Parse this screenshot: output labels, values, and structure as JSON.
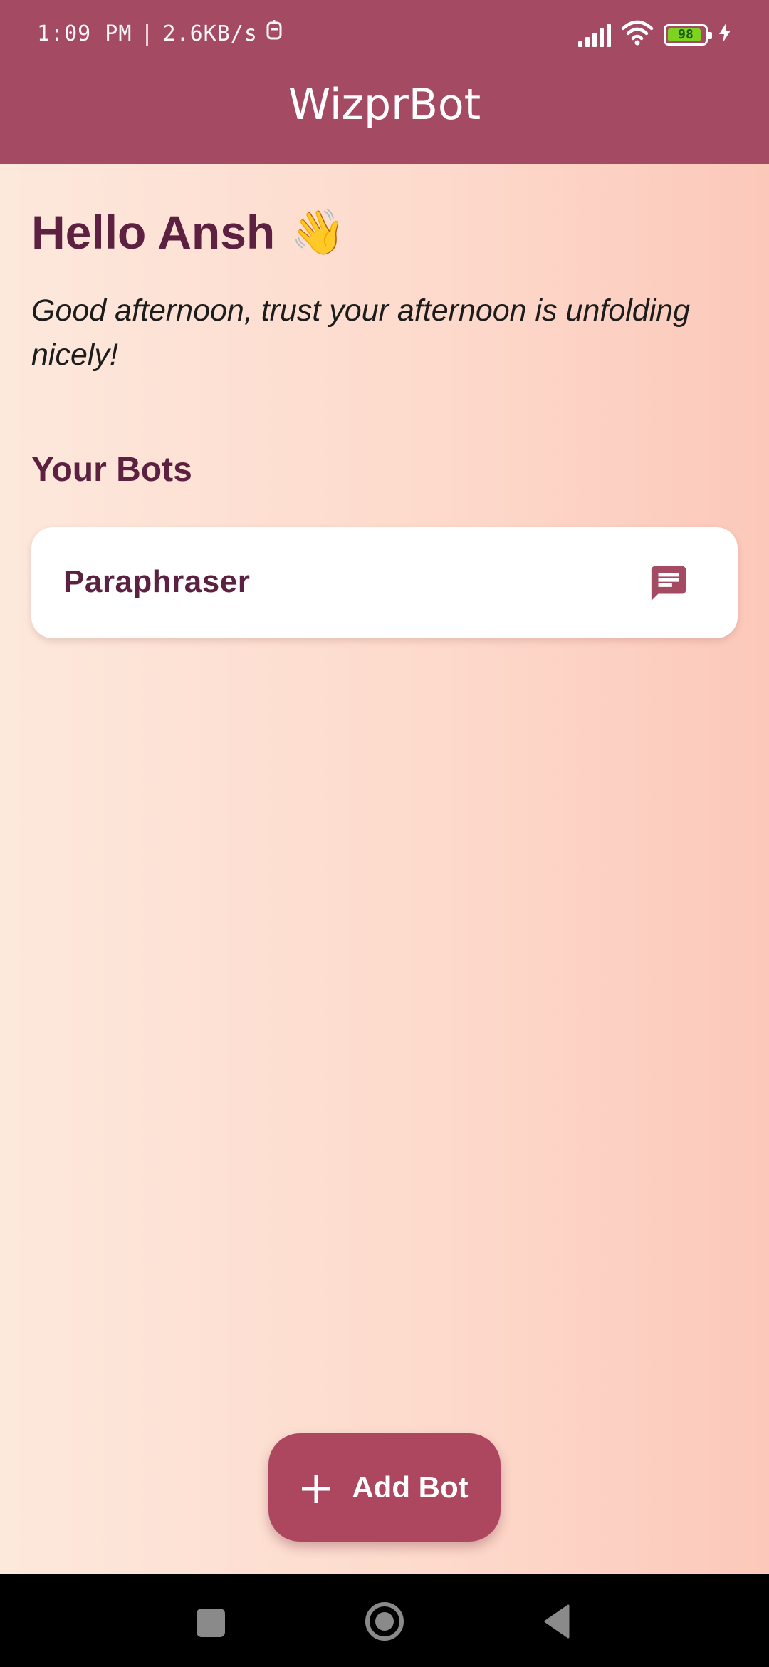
{
  "status_bar": {
    "time": "1:09 PM",
    "separator": "|",
    "speed": "2.6KB/s",
    "battery_level": "98"
  },
  "app_bar": {
    "title": "WizprBot"
  },
  "home": {
    "greeting": "Hello Ansh",
    "greeting_emoji": "👋",
    "subtitle": "Good afternoon, trust your afternoon is unfolding nicely!",
    "section_title": "Your Bots",
    "bots": [
      {
        "name": "Paraphraser",
        "icon": "chat-icon"
      }
    ]
  },
  "fab": {
    "icon": "plus-icon",
    "label": "Add Bot"
  },
  "colors": {
    "primary": "#a44a63",
    "fab": "#ad4760",
    "text_dark": "#5c2140",
    "background_start": "#fde8dc",
    "background_end": "#fcc8ba"
  },
  "nav_bar": {
    "icons": [
      "recents-icon",
      "home-icon",
      "back-icon"
    ]
  }
}
